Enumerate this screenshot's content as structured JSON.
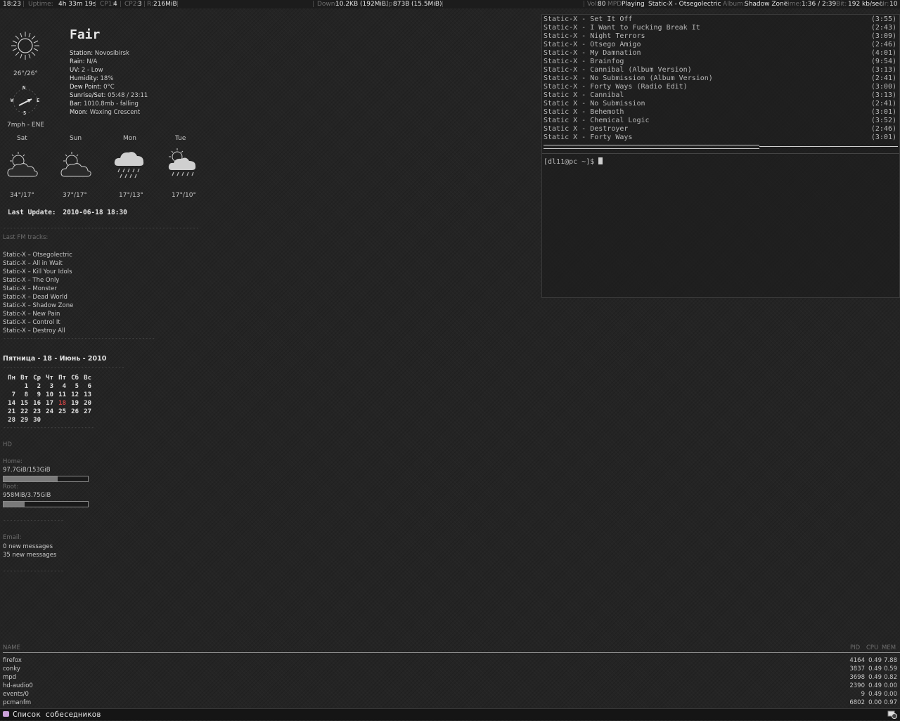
{
  "topbar": {
    "time": "18:23",
    "uptime_label": "Uptime:",
    "uptime": "4h 33m 19s",
    "cp1_label": "CP1:",
    "cp1": "4",
    "cp2_label": "CP2:",
    "cp2": "3",
    "ram_label": "R:",
    "ram": "216MiB",
    "down_label": "Down:",
    "down": "10.2KB (192MiB)",
    "up_label": "Up:",
    "up": "873B",
    "up_total": "(15.5MiB)",
    "vol_label": "Vol:",
    "vol": "80",
    "mpd_label": "MPD",
    "mpd_status": "Playing",
    "track": "Static-X - Otsegolectric",
    "album_label": "Album:",
    "album": "Shadow Zone",
    "time_label": "Time:",
    "track_time": "1:36 / 2:39",
    "bit_label": "Bit:",
    "bitrate": "192 kb/sec",
    "nr_label": "Nr:",
    "nr": "10"
  },
  "weather": {
    "condition": "Fair",
    "temp_range": "26°/26°",
    "wind": "7mph - ENE",
    "compass": {
      "n": "N",
      "s": "S",
      "e": "E",
      "w": "W"
    },
    "details": [
      {
        "label": "Station:",
        "value": "Novosibirsk"
      },
      {
        "label": "Rain:",
        "value": "N/A"
      },
      {
        "label": "UV:",
        "value": "2 - Low"
      },
      {
        "label": "Humidity:",
        "value": "18%"
      },
      {
        "label": "Dew Point:",
        "value": "0°C"
      },
      {
        "label": "Sunrise/Set:",
        "value": "05:48 / 23:11"
      },
      {
        "label": "Bar:",
        "value": "1010.8mb - falling"
      },
      {
        "label": "Moon:",
        "value": "Waxing Crescent"
      }
    ],
    "forecast": [
      {
        "day": "Sat",
        "temps": "34°/17°",
        "icon": "partly-cloudy-icon"
      },
      {
        "day": "Sun",
        "temps": "37°/17°",
        "icon": "partly-cloudy-icon"
      },
      {
        "day": "Mon",
        "temps": "17°/13°",
        "icon": "rain-cloud-icon"
      },
      {
        "day": "Tue",
        "temps": "17°/10°",
        "icon": "sun-rain-icon"
      }
    ],
    "last_update_label": "Last Update:",
    "last_update": "2010-06-18 18:30"
  },
  "lastfm": {
    "header": "Last FM tracks:",
    "tracks": [
      "Static-X – Otsegolectric",
      "Static-X – All in Wait",
      "Static-X – Kill Your Idols",
      "Static-X – The Only",
      "Static-X – Monster",
      "Static-X – Dead World",
      "Static-X – Shadow Zone",
      "Static-X – New Pain",
      "Static-X – Control It",
      "Static-X – Destroy All"
    ]
  },
  "calendar": {
    "title": "Пятница - 18 - Июнь - 2010",
    "weekdays": [
      "Пн",
      "Вт",
      "Ср",
      "Чт",
      "Пт",
      "Сб",
      "Вс"
    ],
    "weeks": [
      [
        "",
        "1",
        "2",
        "3",
        "4",
        "5",
        "6"
      ],
      [
        "7",
        "8",
        "9",
        "10",
        "11",
        "12",
        "13"
      ],
      [
        "14",
        "15",
        "16",
        "17",
        "18",
        "19",
        "20"
      ],
      [
        "21",
        "22",
        "23",
        "24",
        "25",
        "26",
        "27"
      ],
      [
        "28",
        "29",
        "30",
        "",
        "",
        "",
        ""
      ]
    ],
    "today": "18"
  },
  "disks": {
    "header": "HD",
    "items": [
      {
        "label": "Home:",
        "usage": "97.7GiB/153GiB",
        "fraction": 0.64
      },
      {
        "label": "Root:",
        "usage": "958MiB/3.75GiB",
        "fraction": 0.25
      }
    ]
  },
  "email": {
    "header": "Email:",
    "lines": [
      "0 new messages",
      "35 new messages"
    ]
  },
  "playlist": [
    {
      "title": "Static-X - Set It Off",
      "duration": "(3:55)"
    },
    {
      "title": "Static-X - I Want to Fucking Break It",
      "duration": "(2:43)"
    },
    {
      "title": "Static-X - Night Terrors",
      "duration": "(3:09)"
    },
    {
      "title": "Static-X - Otsego Amigo",
      "duration": "(2:46)"
    },
    {
      "title": "Static-X - My Damnation",
      "duration": "(4:01)"
    },
    {
      "title": "Static-X - Brainfog",
      "duration": "(9:54)"
    },
    {
      "title": "Static-X - Cannibal (Album Version)",
      "duration": "(3:13)"
    },
    {
      "title": "Static-X - No Submission (Album Version)",
      "duration": "(2:41)"
    },
    {
      "title": "Static-X - Forty Ways (Radio Edit)",
      "duration": "(3:00)"
    },
    {
      "title": "Static X - Cannibal",
      "duration": "(3:13)"
    },
    {
      "title": "Static X - No Submission",
      "duration": "(2:41)"
    },
    {
      "title": "Static X - Behemoth",
      "duration": "(3:01)"
    },
    {
      "title": "Static X - Chemical Logic",
      "duration": "(3:52)"
    },
    {
      "title": "Static X - Destroyer",
      "duration": "(2:46)"
    },
    {
      "title": "Static X - Forty Ways",
      "duration": "(3:01)"
    }
  ],
  "progress": {
    "fraction": 0.61
  },
  "terminal": {
    "prompt": "[dl11@pc ~]$"
  },
  "processes": {
    "headers": {
      "name": "NAME",
      "pid": "PID",
      "cpu": "CPU",
      "mem": "MEM"
    },
    "rows": [
      {
        "name": "firefox",
        "pid": "4164",
        "cpu": "0.49",
        "mem": "7.88"
      },
      {
        "name": "conky",
        "pid": "3837",
        "cpu": "0.49",
        "mem": "0.59"
      },
      {
        "name": "mpd",
        "pid": "3698",
        "cpu": "0.49",
        "mem": "0.82"
      },
      {
        "name": "hd-audio0",
        "pid": "2390",
        "cpu": "0.49",
        "mem": "0.00"
      },
      {
        "name": "events/0",
        "pid": "9",
        "cpu": "0.49",
        "mem": "0.00"
      },
      {
        "name": "pcmanfm",
        "pid": "6802",
        "cpu": "0.00",
        "mem": "0.97"
      }
    ]
  },
  "taskbar": {
    "label": "Список собеседников",
    "icon": "chat-icon",
    "tray_icon": "tray-icon"
  }
}
